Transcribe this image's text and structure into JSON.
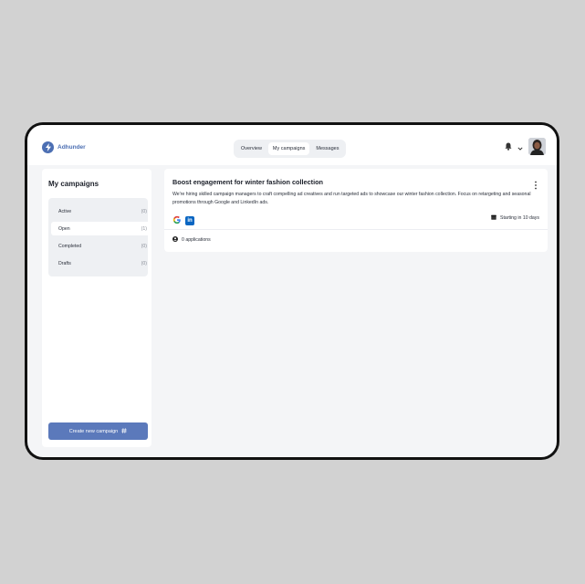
{
  "app": {
    "name": "Adhunder"
  },
  "nav": {
    "tabs": [
      {
        "label": "Overview"
      },
      {
        "label": "My campaigns"
      },
      {
        "label": "Messages"
      }
    ]
  },
  "sidebar": {
    "title": "My campaigns",
    "filters": [
      {
        "label": "Active",
        "count": "(0)"
      },
      {
        "label": "Open",
        "count": "(1)"
      },
      {
        "label": "Completed",
        "count": "(0)"
      },
      {
        "label": "Drafts",
        "count": "(0)"
      }
    ],
    "create_label": "Create new campaign"
  },
  "campaign": {
    "title": "Boost engagement for winter fashion collection",
    "description": "We're hiring skilled campaign managers to craft compelling ad creatives and run targeted ads to showcase our winter fashion collection. Focus on retargeting and seasonal promotions through Google and LinkedIn ads.",
    "channels": [
      "google-icon",
      "linkedin-icon"
    ],
    "linkedin_glyph": "in",
    "start": "Starting in 10 days",
    "applications": "0 applications"
  },
  "colors": {
    "accent": "#5b79bb",
    "brand": "#4c6fb3",
    "linkedin": "#0a66c2"
  }
}
